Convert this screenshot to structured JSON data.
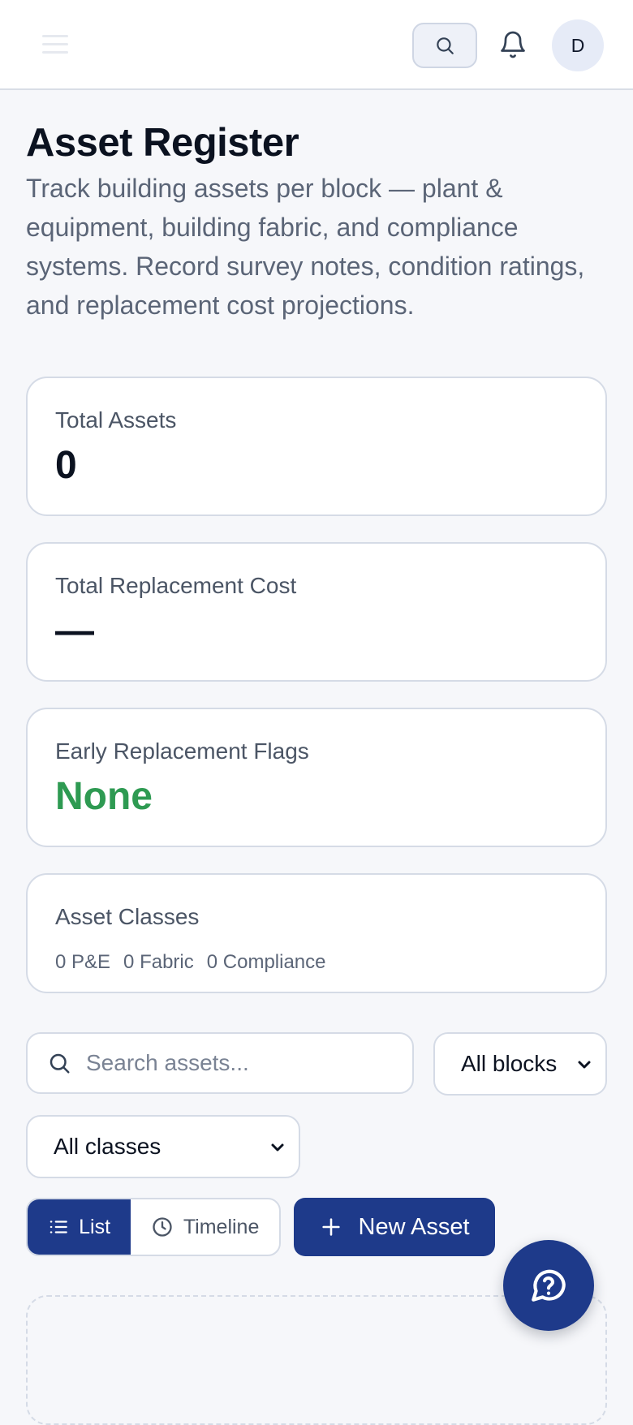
{
  "header": {
    "avatar_initial": "D"
  },
  "page": {
    "title": "Asset Register",
    "description": "Track building assets per block — plant & equipment, building fabric, and compliance systems. Record survey notes, condition ratings, and replacement cost projections."
  },
  "stats": {
    "total_assets": {
      "label": "Total Assets",
      "value": "0"
    },
    "total_cost": {
      "label": "Total Replacement Cost",
      "value": "—"
    },
    "early_flags": {
      "label": "Early Replacement Flags",
      "value": "None",
      "color": "#2e9a52"
    },
    "asset_classes": {
      "label": "Asset Classes",
      "pe": "0 P&E",
      "fabric": "0 Fabric",
      "compliance": "0 Compliance"
    }
  },
  "filters": {
    "search_placeholder": "Search assets...",
    "blocks_selected": "All blocks",
    "classes_selected": "All classes"
  },
  "view_toggle": {
    "list_label": "List",
    "timeline_label": "Timeline"
  },
  "actions": {
    "new_asset_label": "New Asset"
  },
  "colors": {
    "primary": "#1e3a8a",
    "success": "#2e9a52"
  },
  "icons": [
    "menu-icon",
    "search-icon",
    "bell-icon",
    "chevron-down-icon",
    "list-icon",
    "clock-icon",
    "plus-icon",
    "help-icon"
  ]
}
